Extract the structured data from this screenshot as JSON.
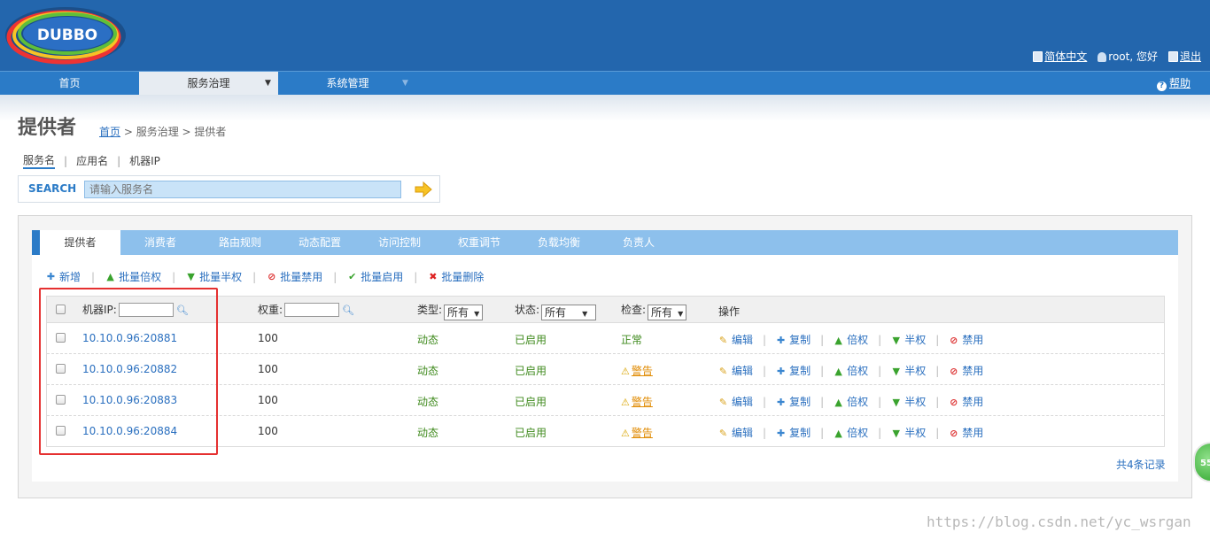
{
  "header": {
    "logo_text": "DUBBO",
    "lang_label": "简体中文",
    "user_label": "root, 您好",
    "logout_label": "退出"
  },
  "nav": {
    "items": [
      {
        "label": "首页"
      },
      {
        "label": "服务治理"
      },
      {
        "label": "系统管理"
      }
    ],
    "help_label": "帮助"
  },
  "page": {
    "title": "提供者",
    "breadcrumb_home": "首页",
    "breadcrumb_rest": " > 服务治理 > 提供者"
  },
  "search": {
    "tabs": [
      "服务名",
      "应用名",
      "机器IP"
    ],
    "label": "SEARCH",
    "placeholder": "请输入服务名"
  },
  "panel_tabs": [
    "提供者",
    "消费者",
    "路由规则",
    "动态配置",
    "访问控制",
    "权重调节",
    "负载均衡",
    "负责人"
  ],
  "toolbar": {
    "add": "新增",
    "batch_double": "批量倍权",
    "batch_half": "批量半权",
    "batch_disable": "批量禁用",
    "batch_enable": "批量启用",
    "batch_delete": "批量删除"
  },
  "table": {
    "headers": {
      "ip": "机器IP:",
      "weight": "权重:",
      "type": "类型:",
      "status": "状态:",
      "check": "检查:",
      "ops": "操作"
    },
    "filter_type": "所有",
    "filter_status": "所有",
    "filter_check": "所有",
    "ops": {
      "edit": "编辑",
      "copy": "复制",
      "double": "倍权",
      "half": "半权",
      "disable": "禁用"
    },
    "rows": [
      {
        "ip": "10.10.0.96:20881",
        "weight": "100",
        "type": "动态",
        "status": "已启用",
        "check": "正常",
        "check_warn": false
      },
      {
        "ip": "10.10.0.96:20882",
        "weight": "100",
        "type": "动态",
        "status": "已启用",
        "check": "警告",
        "check_warn": true
      },
      {
        "ip": "10.10.0.96:20883",
        "weight": "100",
        "type": "动态",
        "status": "已启用",
        "check": "警告",
        "check_warn": true
      },
      {
        "ip": "10.10.0.96:20884",
        "weight": "100",
        "type": "动态",
        "status": "已启用",
        "check": "警告",
        "check_warn": true
      }
    ],
    "total": "共4条记录"
  },
  "badge_text": "55",
  "watermark": "https://blog.csdn.net/yc_wsrgan"
}
